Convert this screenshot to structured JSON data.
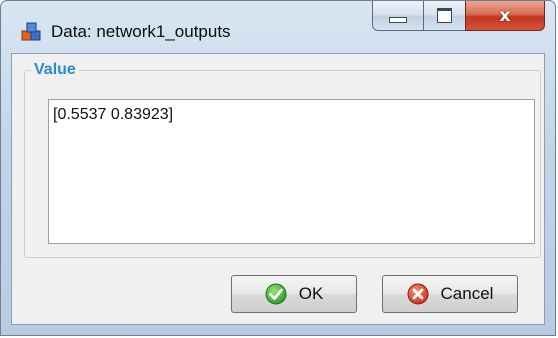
{
  "window": {
    "title": "Data: network1_outputs",
    "app_icon": "data-cubes-icon",
    "controls": {
      "minimize_icon": "minimize-icon",
      "maximize_icon": "maximize-icon",
      "close_icon": "close-icon",
      "close_glyph": "x"
    }
  },
  "group": {
    "label": "Value"
  },
  "value_field": {
    "text": "[0.5537 0.83923]"
  },
  "buttons": {
    "ok": {
      "label": "OK",
      "icon": "checkmark-icon",
      "icon_color": "#2e9e2a"
    },
    "cancel": {
      "label": "Cancel",
      "icon": "cancel-x-icon",
      "icon_color": "#d2331c"
    }
  },
  "colors": {
    "group_label": "#2c8cc9",
    "close_button": "#c1371b"
  }
}
